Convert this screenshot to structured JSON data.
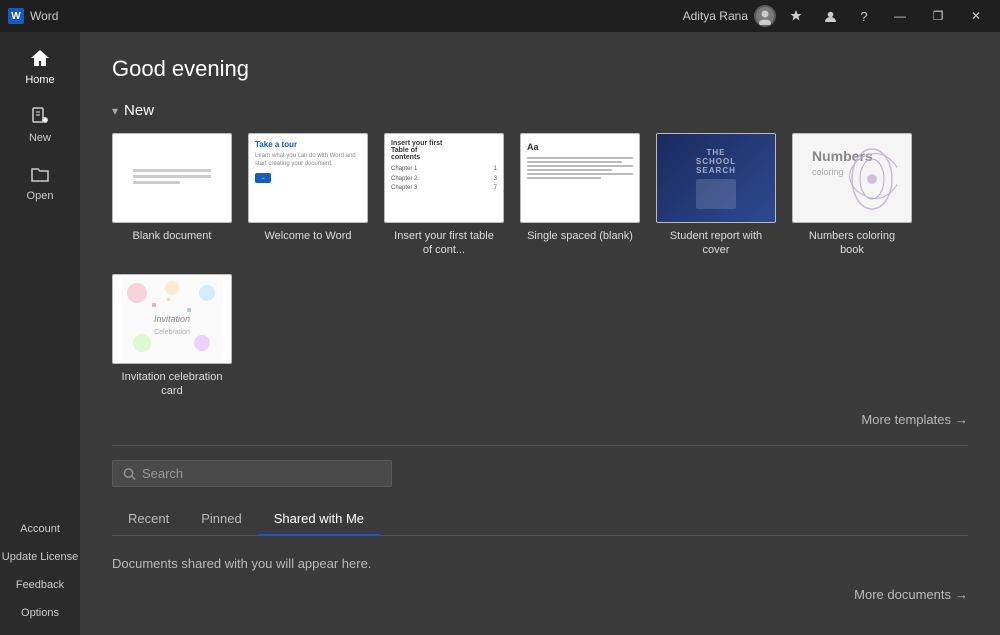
{
  "titleBar": {
    "appName": "Word",
    "title": "Word",
    "userName": "Aditya Rana",
    "windowControls": {
      "minimize": "—",
      "restore": "❐",
      "close": "✕"
    }
  },
  "sidebar": {
    "items": [
      {
        "id": "home",
        "label": "Home",
        "active": true
      },
      {
        "id": "new",
        "label": "New",
        "active": false
      },
      {
        "id": "open",
        "label": "Open",
        "active": false
      }
    ],
    "bottomItems": [
      {
        "id": "account",
        "label": "Account"
      },
      {
        "id": "update-license",
        "label": "Update License"
      },
      {
        "id": "feedback",
        "label": "Feedback"
      },
      {
        "id": "options",
        "label": "Options"
      }
    ]
  },
  "main": {
    "greeting": "Good evening",
    "newSection": {
      "label": "New",
      "moreTemplates": "More templates"
    },
    "templates": [
      {
        "id": "blank",
        "label": "Blank document",
        "type": "blank"
      },
      {
        "id": "welcome",
        "label": "Welcome to Word",
        "type": "welcome"
      },
      {
        "id": "toc",
        "label": "Insert your first table of cont...",
        "type": "toc"
      },
      {
        "id": "single-spaced",
        "label": "Single spaced (blank)",
        "type": "single"
      },
      {
        "id": "student-report",
        "label": "Student report with cover",
        "type": "student"
      },
      {
        "id": "coloring-book",
        "label": "Numbers coloring book",
        "type": "coloring"
      },
      {
        "id": "invitation",
        "label": "Invitation celebration card",
        "type": "invitation"
      }
    ],
    "search": {
      "placeholder": "Search"
    },
    "tabs": [
      {
        "id": "recent",
        "label": "Recent",
        "active": false
      },
      {
        "id": "pinned",
        "label": "Pinned",
        "active": false
      },
      {
        "id": "shared",
        "label": "Shared with Me",
        "active": true
      }
    ],
    "emptyMessage": "Documents shared with you will appear here.",
    "moreDocuments": "More documents"
  }
}
